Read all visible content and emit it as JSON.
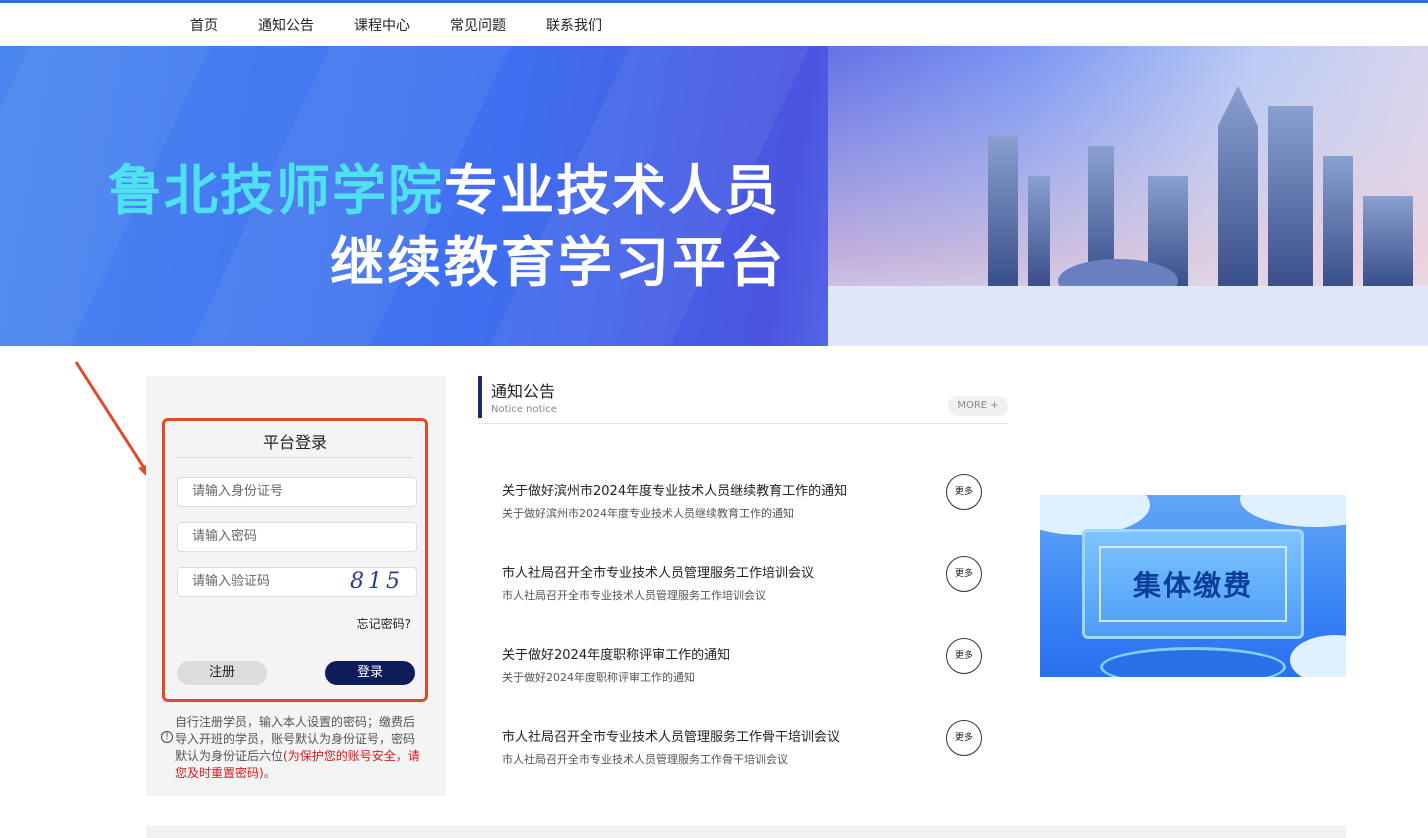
{
  "nav": {
    "items": [
      "首页",
      "通知公告",
      "课程中心",
      "常见问题",
      "联系我们"
    ]
  },
  "banner": {
    "title_highlight": "鲁北技师学院",
    "title_rest": "专业技术人员",
    "title_line2": "继续教育学习平台"
  },
  "login": {
    "title": "平台登录",
    "id_placeholder": "请输入身份证号",
    "password_placeholder": "请输入密码",
    "captcha_placeholder": "请输入验证码",
    "captcha_code": "815",
    "forgot": "忘记密码?",
    "register": "注册",
    "login": "登录",
    "note_main": "自行注册学员，输入本人设置的密码；缴费后导入开班的学员，账号默认为身份证号，密码默认为身份证后六位",
    "note_red": "(为保护您的账号安全，请您及时重置密码)",
    "note_end": "。"
  },
  "notices": {
    "title": "通知公告",
    "subtitle": "Notice notice",
    "more": "MORE +",
    "more_item": "更多",
    "items": [
      {
        "title": "关于做好滨州市2024年度专业技术人员继续教育工作的通知",
        "desc": "关于做好滨州市2024年度专业技术人员继续教育工作的通知"
      },
      {
        "title": "市人社局召开全市专业技术人员管理服务工作培训会议",
        "desc": "市人社局召开全市专业技术人员管理服务工作培训会议"
      },
      {
        "title": "关于做好2024年度职称评审工作的通知",
        "desc": "关于做好2024年度职称评审工作的通知"
      },
      {
        "title": "市人社局召开全市专业技术人员管理服务工作骨干培训会议",
        "desc": "市人社局召开全市专业技术人员管理服务工作骨干培训会议"
      }
    ]
  },
  "group_pay": {
    "label": "集体缴费"
  },
  "colors": {
    "accent": "#2f6fd6",
    "highlight_border": "#e04a2a",
    "login_button": "#0e1c5a",
    "title_highlight": "#4fe0f2"
  }
}
